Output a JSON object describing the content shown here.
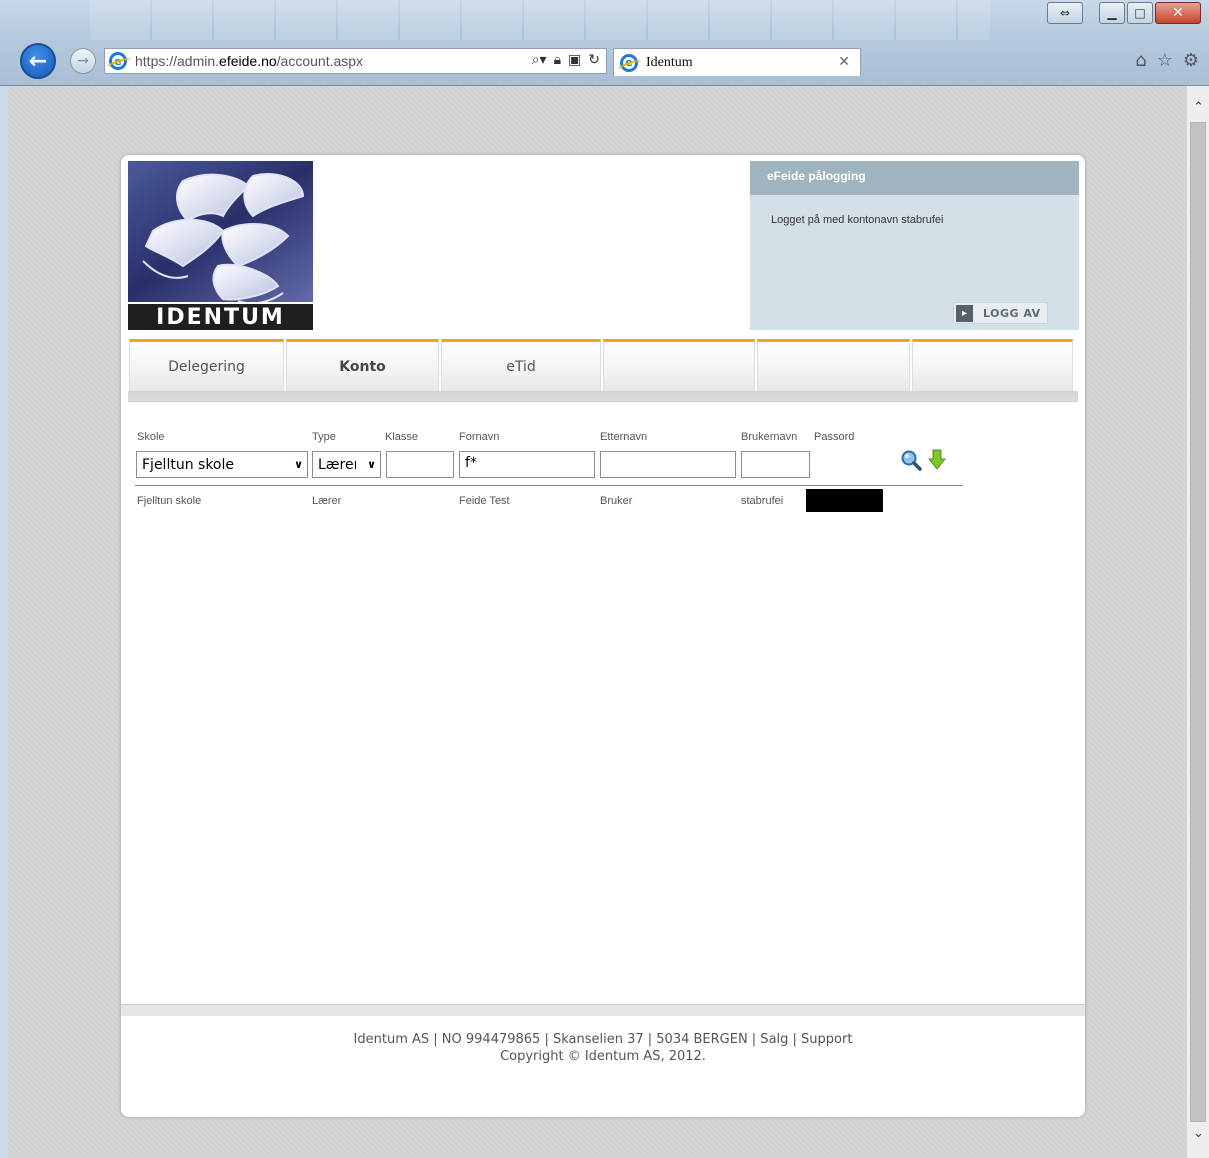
{
  "browser": {
    "url_prefix": "https://admin.",
    "url_domain": "efeide.no",
    "url_path": "/account.aspx",
    "tab_title": "Identum"
  },
  "logo": {
    "wordmark": "IDENTUM"
  },
  "login": {
    "header": "eFeide pålogging",
    "status": "Logget på med kontonavn stabrufei",
    "logout_label": "LOGG AV"
  },
  "nav": {
    "tabs": [
      {
        "label": "Delegering"
      },
      {
        "label": "Konto"
      },
      {
        "label": "eTid"
      },
      {
        "label": ""
      },
      {
        "label": ""
      },
      {
        "label": ""
      }
    ]
  },
  "filter": {
    "labels": {
      "skole": "Skole",
      "type": "Type",
      "klasse": "Klasse",
      "fornavn": "Fornavn",
      "etternavn": "Etternavn",
      "brukernavn": "Brukernavn",
      "passord": "Passord"
    },
    "values": {
      "skole": "Fjelltun skole",
      "type": "Lærer",
      "klasse": "",
      "fornavn": "f*",
      "etternavn": "",
      "brukernavn": ""
    }
  },
  "results": [
    {
      "skole": "Fjelltun skole",
      "type": "Lærer",
      "fornavn": "Feide Test",
      "etternavn": "Bruker",
      "brukernavn": "stabrufei"
    }
  ],
  "footer": {
    "line1": "Identum AS | NO 994479865 | Skanselien 37 | 5034 BERGEN | Salg | Support",
    "line2": "Copyright © Identum AS, 2012."
  },
  "colors": {
    "accent": "#f7a21b",
    "login_header": "#9fb3c1",
    "login_box": "#d4e0e8"
  }
}
